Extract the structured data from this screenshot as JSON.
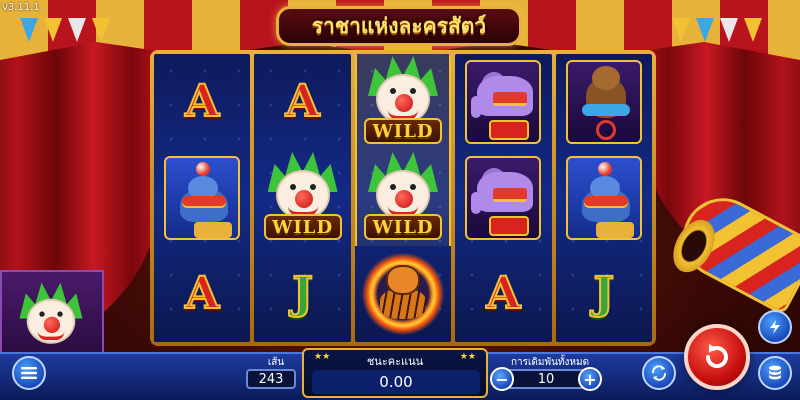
{
  "app": {
    "version": "v3.11.1",
    "title": "ราชาแห่งละครสัตว์"
  },
  "reels": [
    [
      "A",
      "seal",
      "A"
    ],
    [
      "A",
      "WILD",
      "J"
    ],
    [
      "WILD",
      "WILD",
      "tiger"
    ],
    [
      "elephant",
      "elephant",
      "A"
    ],
    [
      "bear",
      "seal",
      "J"
    ]
  ],
  "wild_label": "WILD",
  "bottom": {
    "lines_label": "เส้น",
    "lines_value": "243",
    "win_label": "ชนะคะแนน",
    "win_value": "0.00",
    "bet_label": "การเดิมพันทั้งหมด",
    "bet_value": "10",
    "minus": "−",
    "plus": "+"
  },
  "icons": [
    "menu-icon",
    "turbo-icon",
    "autoplay-icon",
    "spin-icon",
    "coins-icon"
  ],
  "colors": {
    "accent_gold": "#e8b13a",
    "bar_blue": "#1e3c9e",
    "spin_red": "#c8100e"
  }
}
